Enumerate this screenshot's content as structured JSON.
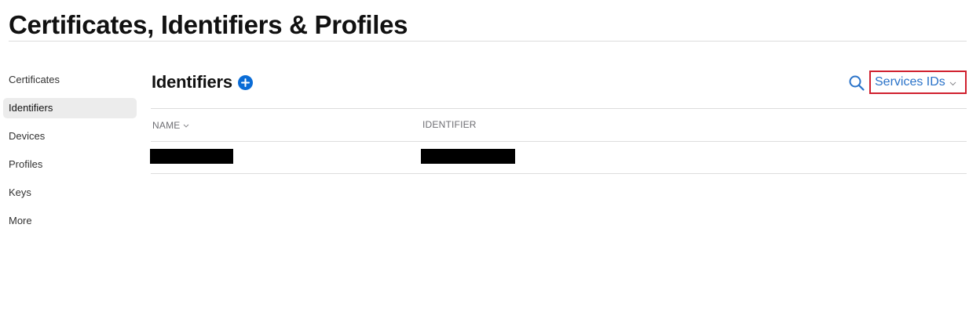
{
  "page": {
    "title": "Certificates, Identifiers & Profiles"
  },
  "sidebar": {
    "items": [
      {
        "label": "Certificates",
        "active": false
      },
      {
        "label": "Identifiers",
        "active": true
      },
      {
        "label": "Devices",
        "active": false
      },
      {
        "label": "Profiles",
        "active": false
      },
      {
        "label": "Keys",
        "active": false
      },
      {
        "label": "More",
        "active": false
      }
    ]
  },
  "main": {
    "section_title": "Identifiers",
    "add_icon": "plus-circle-icon",
    "search_icon": "search-icon",
    "filter": {
      "selected": "Services IDs",
      "icon": "chevron-down-icon"
    },
    "table": {
      "columns": [
        "NAME",
        "IDENTIFIER"
      ],
      "sorted_column": "NAME",
      "rows": [
        {
          "name": "",
          "identifier": "",
          "redacted": true
        }
      ]
    }
  },
  "colors": {
    "accent": "#0a6cd6",
    "link": "#2a73c9",
    "highlight_border": "#d0202e",
    "active_item_bg": "#ececec",
    "divider": "#dddddd"
  }
}
